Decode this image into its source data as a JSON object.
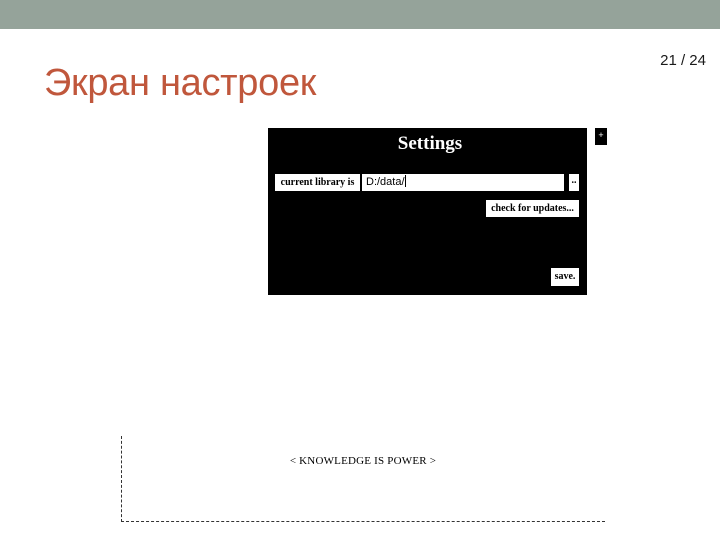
{
  "slide": {
    "title": "Экран настроек",
    "page_counter": "21 / 24"
  },
  "settings": {
    "title": "Settings",
    "library_label": "current library is",
    "library_value": "D:/data/",
    "browse_label": "..",
    "check_updates_label": "check for updates...",
    "save_label": "save.",
    "close_label": "+"
  },
  "motto": "< KNOWLEDGE IS POWER >",
  "colors": {
    "top_bar": "#95a39a",
    "title": "#c0573c",
    "panel": "#000000"
  }
}
